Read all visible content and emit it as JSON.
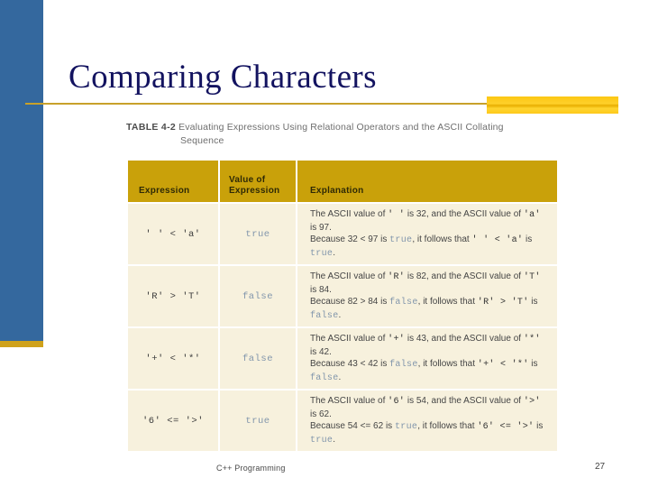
{
  "slide": {
    "title": "Comparing Characters",
    "theme": {
      "sidebar_color": "#34689e",
      "rule_color": "#c8a12a",
      "accent_block_color": "#ffd02b",
      "title_color": "#131360",
      "table_header_color": "#c9a10a",
      "table_cell_color": "#f7f1dd",
      "bool_text_color": "#8296ac"
    }
  },
  "caption": {
    "label": "TABLE 4-2",
    "line1": "Evaluating Expressions Using Relational Operators and the ASCII Collating",
    "line2": "Sequence"
  },
  "table": {
    "headers": {
      "expression": "Expression",
      "value_line1": "Value of",
      "value_line2": "Expression",
      "explanation": "Explanation"
    },
    "rows": [
      {
        "expression": "' ' < 'a'",
        "value": "true",
        "explanation_parts": [
          {
            "t": "The ASCII value of ",
            "k": "text"
          },
          {
            "t": "' '",
            "k": "mono"
          },
          {
            "t": " is 32, and the ASCII value of ",
            "k": "text"
          },
          {
            "t": "'a'",
            "k": "mono"
          },
          {
            "t": " is 97.",
            "k": "text"
          },
          {
            "t": "\n",
            "k": "br"
          },
          {
            "t": "Because 32 < 97 is ",
            "k": "text"
          },
          {
            "t": "true",
            "k": "bool"
          },
          {
            "t": ", it follows that ",
            "k": "text"
          },
          {
            "t": "' ' < 'a'",
            "k": "mono"
          },
          {
            "t": " is ",
            "k": "text"
          },
          {
            "t": "true",
            "k": "bool"
          },
          {
            "t": ".",
            "k": "text"
          }
        ]
      },
      {
        "expression": "'R' > 'T'",
        "value": "false",
        "explanation_parts": [
          {
            "t": "The ASCII value of ",
            "k": "text"
          },
          {
            "t": "'R'",
            "k": "mono"
          },
          {
            "t": " is 82, and the ASCII value of ",
            "k": "text"
          },
          {
            "t": "'T'",
            "k": "mono"
          },
          {
            "t": " is 84.",
            "k": "text"
          },
          {
            "t": "\n",
            "k": "br"
          },
          {
            "t": "Because 82 > 84 is ",
            "k": "text"
          },
          {
            "t": "false",
            "k": "bool"
          },
          {
            "t": ", it follows that ",
            "k": "text"
          },
          {
            "t": "'R' > 'T'",
            "k": "mono"
          },
          {
            "t": " is ",
            "k": "text"
          },
          {
            "t": "false",
            "k": "bool"
          },
          {
            "t": ".",
            "k": "text"
          }
        ]
      },
      {
        "expression": "'+' < '*'",
        "value": "false",
        "explanation_parts": [
          {
            "t": "The ASCII value of ",
            "k": "text"
          },
          {
            "t": "'+'",
            "k": "mono"
          },
          {
            "t": " is 43, and the ASCII value of ",
            "k": "text"
          },
          {
            "t": "'*'",
            "k": "mono"
          },
          {
            "t": " is 42.",
            "k": "text"
          },
          {
            "t": "\n",
            "k": "br"
          },
          {
            "t": "Because 43 < 42 is ",
            "k": "text"
          },
          {
            "t": "false",
            "k": "bool"
          },
          {
            "t": ", it follows that ",
            "k": "text"
          },
          {
            "t": "'+' < '*'",
            "k": "mono"
          },
          {
            "t": " is ",
            "k": "text"
          },
          {
            "t": "false",
            "k": "bool"
          },
          {
            "t": ".",
            "k": "text"
          }
        ]
      },
      {
        "expression": "'6' <= '>'",
        "value": "true",
        "explanation_parts": [
          {
            "t": "The ASCII value of ",
            "k": "text"
          },
          {
            "t": "'6'",
            "k": "mono"
          },
          {
            "t": " is 54, and the ASCII value of ",
            "k": "text"
          },
          {
            "t": "'>'",
            "k": "mono"
          },
          {
            "t": " is 62.",
            "k": "text"
          },
          {
            "t": "\n",
            "k": "br"
          },
          {
            "t": "Because 54 <= 62 is ",
            "k": "text"
          },
          {
            "t": "true",
            "k": "bool"
          },
          {
            "t": ", it follows that ",
            "k": "text"
          },
          {
            "t": "'6' <= '>'",
            "k": "mono"
          },
          {
            "t": " is ",
            "k": "text"
          },
          {
            "t": "true",
            "k": "bool"
          },
          {
            "t": ".",
            "k": "text"
          }
        ]
      }
    ]
  },
  "footer": {
    "course": "C++ Programming",
    "page_number": "27"
  }
}
